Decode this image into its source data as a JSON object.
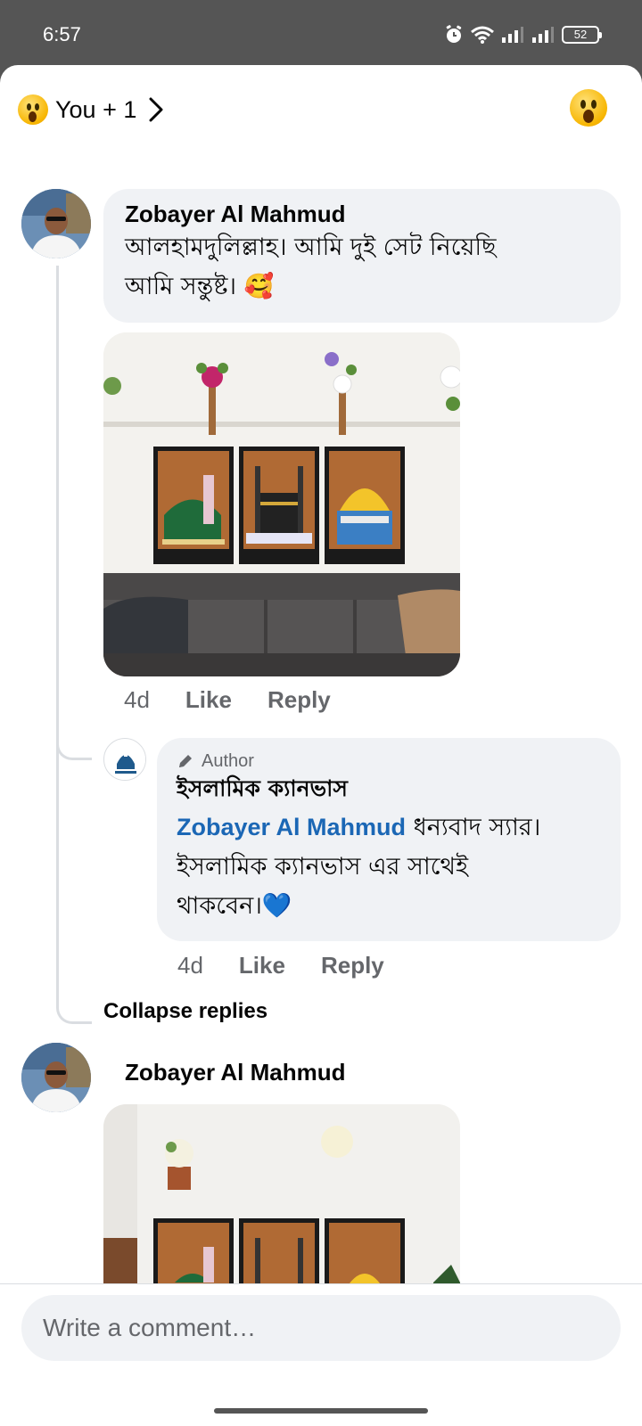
{
  "status_bar": {
    "time": "6:57",
    "battery": "52",
    "icons": [
      "alarm-icon",
      "wifi-icon",
      "signal-icon",
      "signal-icon",
      "battery-icon"
    ]
  },
  "header": {
    "reaction_summary": "You + 1",
    "reaction_icon": "wow-emoji-icon",
    "chevron_icon": "chevron-right-icon"
  },
  "comments": [
    {
      "author": "Zobayer Al Mahmud",
      "text": "আলহামদুলিল্লাহ। আমি দুই সেট নিয়েছি আমি সন্তুষ্ট। 🥰",
      "text_line1": "আলহামদুলিল্লাহ। আমি দুই সেট নিয়েছি",
      "text_line2": "আমি সন্তুষ্ট। 🥰",
      "time": "4d",
      "like_label": "Like",
      "reply_label": "Reply",
      "reply": {
        "badge": "Author",
        "page_name": "ইসলামিক ক্যানভাস",
        "mention": "Zobayer Al Mahmud",
        "text_line1_rest": " ধন্যবাদ স্যার।",
        "text_line2": "ইসলামিক ক্যানভাস এর সাথেই",
        "text_line3": "থাকবেন।💙",
        "time": "4d",
        "like_label": "Like",
        "reply_label": "Reply"
      },
      "collapse_label": "Collapse replies"
    },
    {
      "author": "Zobayer Al Mahmud"
    }
  ],
  "composer": {
    "placeholder": "Write a comment…"
  },
  "colors": {
    "bubble": "#f0f2f5",
    "mention": "#1b67b5",
    "muted": "#65676b",
    "status_bar": "#555555"
  }
}
